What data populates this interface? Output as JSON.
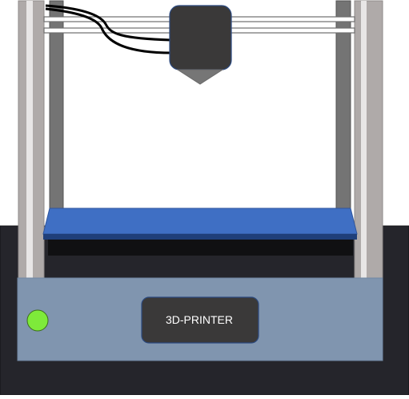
{
  "printer": {
    "label": "3D-PRINTER",
    "colors": {
      "base": "#25252b",
      "front_panel": "#8095af",
      "bed": "#3f6fc4",
      "bed_edge": "#1f3f7a",
      "bed_support": "#101012",
      "rail": "#afaaa9",
      "rail_inner": "#747474",
      "print_head": "#3a3939",
      "nozzle": "#767676",
      "cable": "#000000",
      "status_light": "#7eea3a",
      "label_box": "#3a3939",
      "label_text": "#ffffff"
    }
  }
}
